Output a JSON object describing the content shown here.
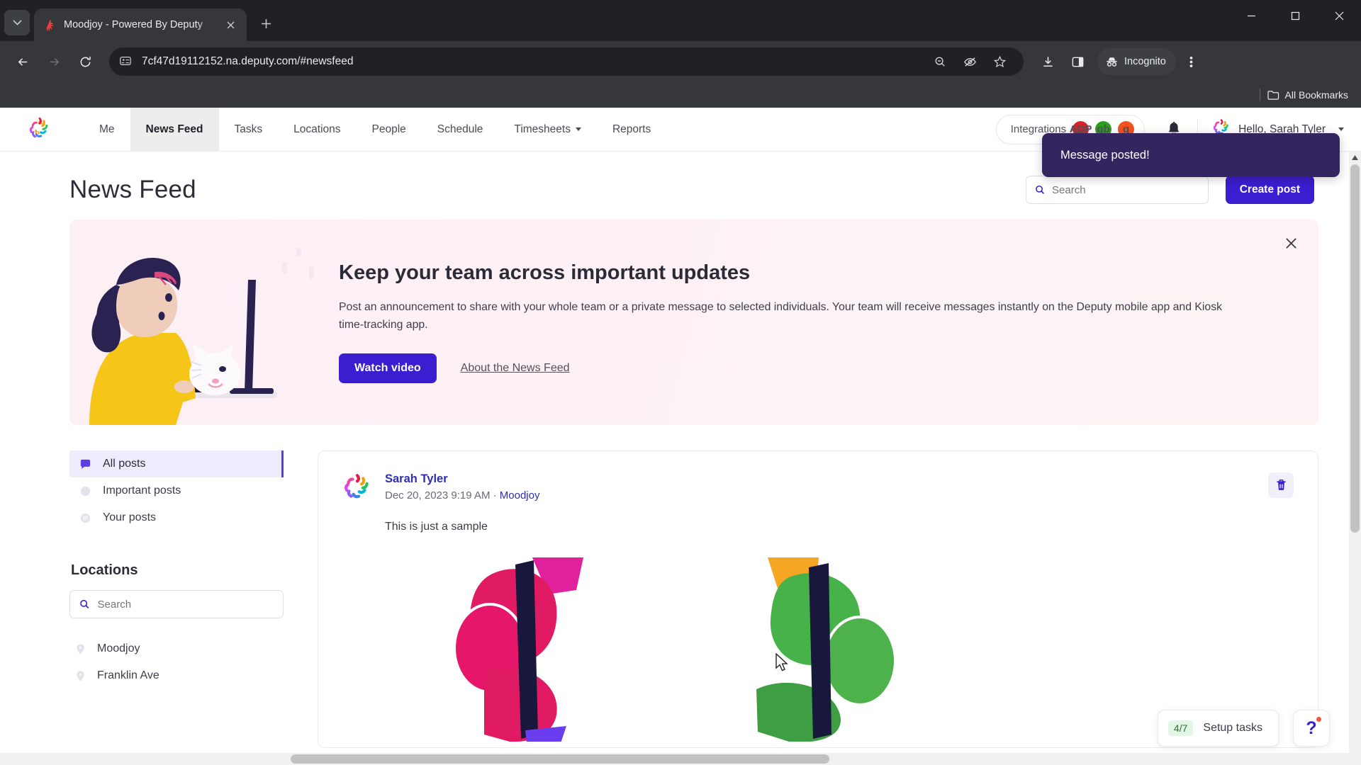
{
  "browser": {
    "tab": {
      "title": "Moodjoy - Powered By Deputy",
      "favicon": "deputy-logo-icon"
    },
    "new_tab_label": "+",
    "url": "7cf47d19112152.na.deputy.com/#newsfeed",
    "toolbar_icons": [
      "back-icon",
      "forward-icon",
      "reload-icon",
      "site-info-icon",
      "zoom-out-icon",
      "tracking-protection-icon",
      "bookmark-star-icon",
      "downloads-icon",
      "side-panel-icon",
      "menu-icon"
    ],
    "incognito_label": "Incognito",
    "bookmarks_label": "All Bookmarks",
    "window_controls": [
      "minimize",
      "maximize",
      "close"
    ]
  },
  "app": {
    "nav_items": [
      {
        "label": "Me",
        "active": false,
        "dropdown": false
      },
      {
        "label": "News Feed",
        "active": true,
        "dropdown": false
      },
      {
        "label": "Tasks",
        "active": false,
        "dropdown": false
      },
      {
        "label": "Locations",
        "active": false,
        "dropdown": false
      },
      {
        "label": "People",
        "active": false,
        "dropdown": false
      },
      {
        "label": "Schedule",
        "active": false,
        "dropdown": false
      },
      {
        "label": "Timesheets",
        "active": false,
        "dropdown": true
      },
      {
        "label": "Reports",
        "active": false,
        "dropdown": false
      }
    ],
    "integrations": {
      "label": "Integrations",
      "badges": [
        {
          "name": "adp",
          "glyph": "ADP",
          "color": "#d7252c"
        },
        {
          "name": "quickbooks",
          "glyph": "qb",
          "color": "#2ca01c"
        },
        {
          "name": "gusto",
          "glyph": "g",
          "color": "#f4511e"
        }
      ]
    },
    "notifications_icon": "bell-icon",
    "user": {
      "greeting": "Hello, Sarah Tyler",
      "avatar": "deputy-star-avatar"
    }
  },
  "toast": {
    "message": "Message posted!"
  },
  "page": {
    "title": "News Feed",
    "search": {
      "placeholder": "Search",
      "value": ""
    },
    "create_post_label": "Create post"
  },
  "banner": {
    "heading": "Keep your team across important updates",
    "paragraph": "Post an announcement to share with your whole team or a private message to selected individuals. Your team will receive messages instantly on the Deputy mobile app and Kiosk time-tracking app.",
    "watch_label": "Watch video",
    "about_label": "About the News Feed",
    "close_icon": "close-icon"
  },
  "sidebar": {
    "filters": [
      {
        "label": "All posts",
        "icon": "chat-bubble-icon",
        "active": true
      },
      {
        "label": "Important posts",
        "icon": "alert-icon",
        "active": false
      },
      {
        "label": "Your posts",
        "icon": "user-posts-icon",
        "active": false
      }
    ],
    "locations_heading": "Locations",
    "locations_search": {
      "placeholder": "Search",
      "value": ""
    },
    "locations": [
      {
        "label": "Moodjoy",
        "icon": "map-pin-icon"
      },
      {
        "label": "Franklin Ave",
        "icon": "map-pin-icon"
      }
    ]
  },
  "post": {
    "author": "Sarah Tyler",
    "timestamp": "Dec 20, 2023 9:19 AM",
    "separator": "·",
    "location": "Moodjoy",
    "body": "This is just a sample",
    "delete_icon": "trash-icon",
    "avatar": "deputy-star-avatar"
  },
  "floaters": {
    "setup_count": "4/7",
    "setup_label": "Setup tasks",
    "help_label": "?"
  }
}
